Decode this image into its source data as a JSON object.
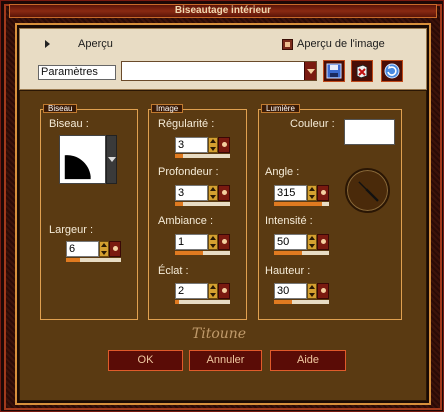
{
  "window": {
    "title": "Biseautage intérieur"
  },
  "top": {
    "preview_label": "Aperçu",
    "preview_image_label": "Aperçu de l'image",
    "presets_label": "Paramètres",
    "presets_value": ""
  },
  "bevel": {
    "group_title": "Biseau",
    "bevel_label": "Biseau :",
    "width_label": "Largeur :",
    "width_value": "6",
    "width_fill": 0.25
  },
  "image": {
    "group_title": "Image",
    "smoothness_label": "Régularité :",
    "smoothness_value": "3",
    "smoothness_fill": 0.15,
    "depth_label": "Profondeur :",
    "depth_value": "3",
    "depth_fill": 0.15,
    "ambience_label": "Ambiance :",
    "ambience_value": "1",
    "ambience_fill": 0.5,
    "shine_label": "Éclat :",
    "shine_value": "2",
    "shine_fill": 0.08
  },
  "light": {
    "group_title": "Lumière",
    "color_label": "Couleur :",
    "color_value": "#ffffff",
    "angle_label": "Angle :",
    "angle_value": "315",
    "angle_fill": 0.88,
    "intensity_label": "Intensité :",
    "intensity_value": "50",
    "intensity_fill": 0.5,
    "elevation_label": "Hauteur :",
    "elevation_value": "30",
    "elevation_fill": 0.33
  },
  "brand": "Titoune",
  "buttons": {
    "ok": "OK",
    "cancel": "Annuler",
    "help": "Aide"
  },
  "colors": {
    "accent": "#e07a20",
    "panel": "#5a3a12",
    "button": "#5a0c06"
  }
}
